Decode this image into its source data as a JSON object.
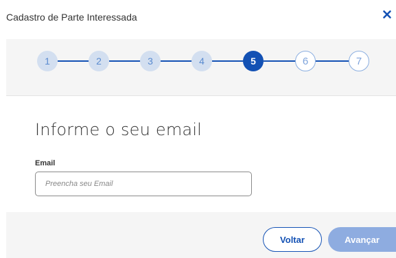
{
  "modal": {
    "title": "Cadastro de Parte Interessada",
    "close_icon": "close-icon"
  },
  "stepper": {
    "current_step": 5,
    "steps": [
      {
        "label": "1",
        "state": "done"
      },
      {
        "label": "2",
        "state": "done"
      },
      {
        "label": "3",
        "state": "done"
      },
      {
        "label": "4",
        "state": "done"
      },
      {
        "label": "5",
        "state": "active"
      },
      {
        "label": "6",
        "state": "pending"
      },
      {
        "label": "7",
        "state": "pending"
      }
    ]
  },
  "form": {
    "heading": "Informe o seu email",
    "email_label": "Email",
    "email_placeholder": "Preencha seu Email",
    "email_value": ""
  },
  "footer": {
    "back_label": "Voltar",
    "next_label": "Avançar"
  },
  "colors": {
    "primary": "#1351b4",
    "step_done_bg": "#d3dff0",
    "next_button_disabled": "#8eace0",
    "band_bg": "#f5f5f5"
  }
}
